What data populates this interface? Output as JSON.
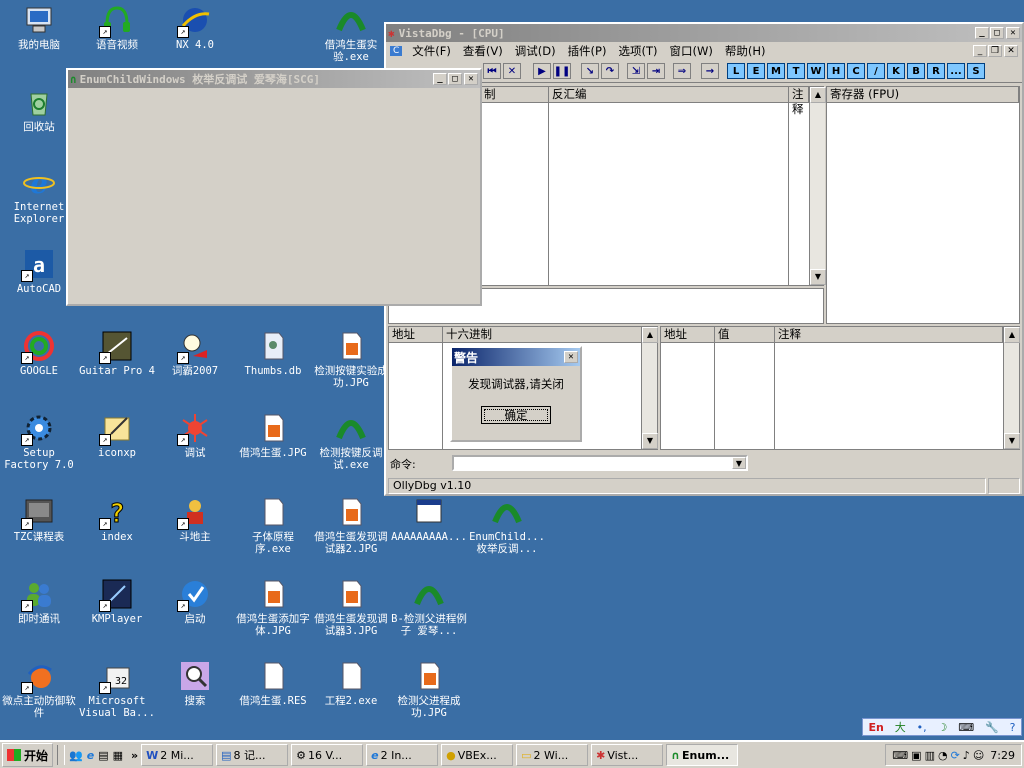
{
  "desktop": {
    "icons": [
      {
        "label": "我的电脑"
      },
      {
        "label": "语音视频"
      },
      {
        "label": "NX 4.0"
      },
      {
        "label": "借鸿生蛋实验.exe"
      },
      {
        "label": "回收站"
      },
      {
        "label": "Internet Explorer"
      },
      {
        "label": "AutoCAD"
      },
      {
        "label": "GOOGLE"
      },
      {
        "label": "Guitar Pro 4"
      },
      {
        "label": "词霸2007"
      },
      {
        "label": "Thumbs.db"
      },
      {
        "label": "检测按键实验成功.JPG"
      },
      {
        "label": "Setup Factory 7.0"
      },
      {
        "label": "iconxp"
      },
      {
        "label": "调试"
      },
      {
        "label": "借鸿生蛋.JPG"
      },
      {
        "label": "检测按键反调试.exe"
      },
      {
        "label": "TZC课程表"
      },
      {
        "label": "index"
      },
      {
        "label": "斗地主"
      },
      {
        "label": "子体原程序.exe"
      },
      {
        "label": "借鸿生蛋发现调试器2.JPG"
      },
      {
        "label": "AAAAAAAAA..."
      },
      {
        "label": "EnumChild... 枚举反调..."
      },
      {
        "label": "即时通讯"
      },
      {
        "label": "KMPlayer"
      },
      {
        "label": "启动"
      },
      {
        "label": "借鸿生蛋添加字体.JPG"
      },
      {
        "label": "借鸿生蛋发现调试器3.JPG"
      },
      {
        "label": "B-检测父进程例子 爱琴..."
      },
      {
        "label": "微点主动防御软件"
      },
      {
        "label": "Microsoft Visual Ba..."
      },
      {
        "label": "搜索"
      },
      {
        "label": "借鸿生蛋.RES"
      },
      {
        "label": "工程2.exe"
      },
      {
        "label": "检测父进程成功.JPG"
      }
    ]
  },
  "enum_window": {
    "title": "EnumChildWindows 枚举反调试 爱琴海[SCG]"
  },
  "olly": {
    "title": "VistaDbg - [CPU]",
    "menu": [
      "文件(F)",
      "查看(V)",
      "调试(D)",
      "插件(P)",
      "选项(T)",
      "窗口(W)",
      "帮助(H)"
    ],
    "toolbar_letters": [
      "L",
      "E",
      "M",
      "T",
      "W",
      "H",
      "C",
      "/",
      "K",
      "B",
      "R",
      "...",
      "S"
    ],
    "disasm_headers": [
      "制",
      "反汇编",
      "注释"
    ],
    "registers_header": "寄存器 (FPU)",
    "dump_headers": [
      "地址",
      "十六进制"
    ],
    "stack_headers": [
      "地址",
      "值",
      "注释"
    ],
    "command_label": "命令:",
    "status": "OllyDbg v1.10"
  },
  "dialog": {
    "title": "警告",
    "message": "发现调试器,请关闭",
    "ok": "确定"
  },
  "taskbar": {
    "start": "开始",
    "tasks": [
      "2 Mi...",
      "8 记...",
      "16 V...",
      "2 In...",
      "VBEx...",
      "2 Wi...",
      "Vist...",
      "Enum..."
    ],
    "clock": "7:29"
  },
  "colors": {
    "desktop": "#3a6ea5",
    "title_active": "#0a246a",
    "title_inactive": "#808080",
    "toolbar_letter": "#7fc7ff"
  }
}
